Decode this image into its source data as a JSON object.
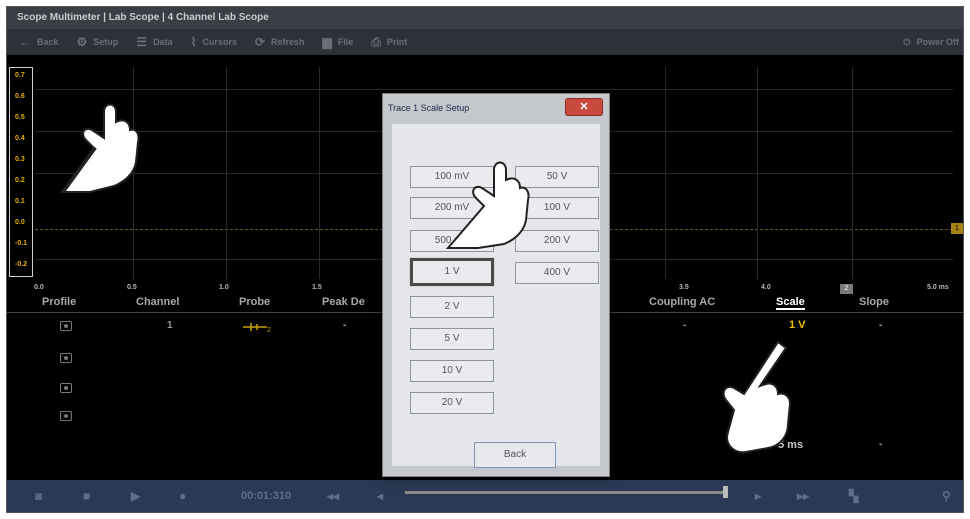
{
  "window_title": "Scope Multimeter | Lab Scope | 4 Channel Lab Scope",
  "toolbar": {
    "back": "Back",
    "setup": "Setup",
    "data": "Data",
    "cursors": "Cursors",
    "refresh": "Refresh",
    "file": "File",
    "print": "Print",
    "power_off": "Power Off"
  },
  "graph": {
    "y_ticks": [
      "0.7",
      "0.6",
      "0.5",
      "0.4",
      "0.3",
      "0.2",
      "0.1",
      "0.0",
      "-0.1",
      "-0.2"
    ],
    "x_ticks": [
      "0.0",
      "0.5",
      "1.0",
      "1.5",
      "3.5",
      "4.0",
      "5.0 ms"
    ],
    "trace_marker": "1",
    "trigger_marker": "2",
    "trace_color": "#e8b000"
  },
  "table": {
    "headers": {
      "profile": "Profile",
      "channel": "Channel",
      "probe": "Probe",
      "peak_detect": "Peak De",
      "coupling": "Coupling AC",
      "scale": "Scale",
      "slope": "Slope"
    },
    "row1": {
      "channel": "1",
      "probe_icon": "probe-icon",
      "peak_detect": "-",
      "coupling": "-",
      "scale": "1 V",
      "slope": "-"
    },
    "row4": {
      "scale": "5 ms",
      "slope": "-"
    }
  },
  "bottom": {
    "time": "00:01:310"
  },
  "dialog": {
    "title": "Trace 1 Scale Setup",
    "close": "✕",
    "options_left": [
      "100 mV",
      "200 mV",
      "500 mV",
      "1 V",
      "2 V",
      "5 V",
      "10 V",
      "20 V"
    ],
    "options_right": [
      "50 V",
      "100 V",
      "200 V",
      "400 V"
    ],
    "selected": "1 V",
    "back": "Back"
  }
}
